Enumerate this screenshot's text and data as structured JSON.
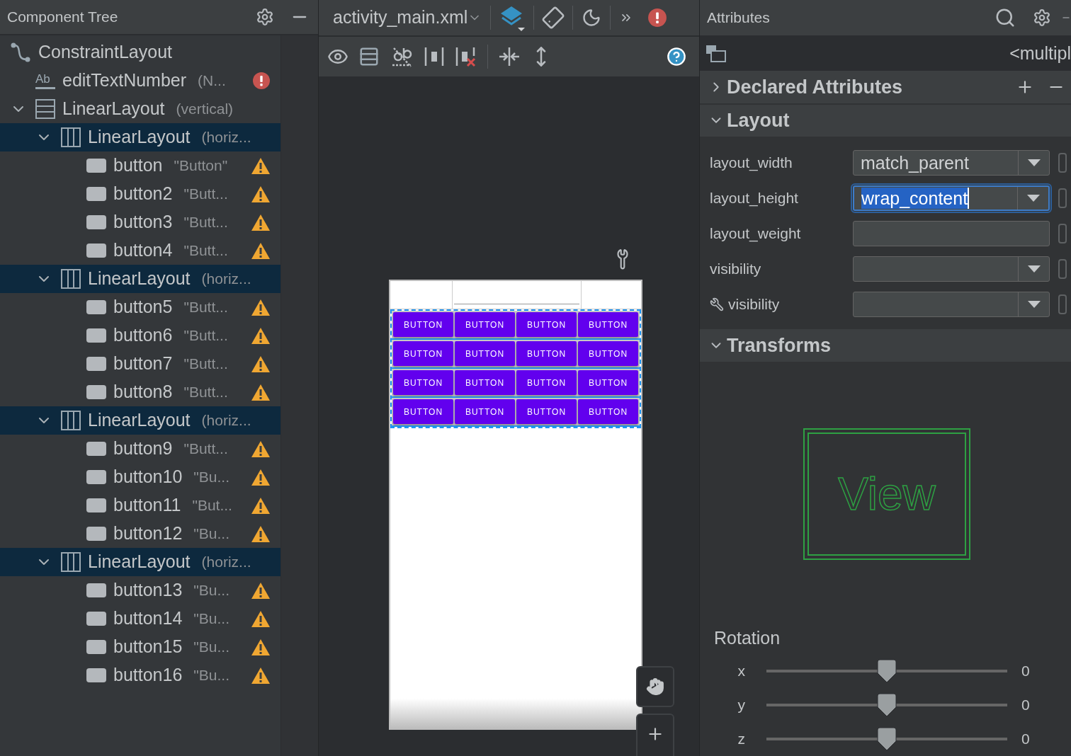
{
  "tree_panel": {
    "title": "Component Tree"
  },
  "component_tree": [
    {
      "name": "ConstraintLayout",
      "kind": "constraint",
      "selected": false,
      "error": false,
      "warning": false,
      "children": [
        {
          "name": "editTextNumber",
          "detail": "(N...",
          "kind": "edittext",
          "icon_label": "Ab",
          "error": true,
          "warning": false,
          "selected": false
        },
        {
          "name": "LinearLayout",
          "detail": "(vertical)",
          "kind": "linear_vertical",
          "expanded": true,
          "selected": false,
          "error": false,
          "warning": false,
          "children": [
            {
              "name": "LinearLayout",
              "detail": "(horiz...",
              "kind": "linear_horizontal",
              "expanded": true,
              "selected": true,
              "error": false,
              "warning": false,
              "children": [
                {
                  "name": "button",
                  "detail": "\"Button\"",
                  "kind": "button",
                  "error": false,
                  "warning": true,
                  "selected": false
                },
                {
                  "name": "button2",
                  "detail": "\"Butt...",
                  "kind": "button",
                  "error": false,
                  "warning": true,
                  "selected": false
                },
                {
                  "name": "button3",
                  "detail": "\"Butt...",
                  "kind": "button",
                  "error": false,
                  "warning": true,
                  "selected": false
                },
                {
                  "name": "button4",
                  "detail": "\"Butt...",
                  "kind": "button",
                  "error": false,
                  "warning": true,
                  "selected": false
                }
              ]
            },
            {
              "name": "LinearLayout",
              "detail": "(horiz...",
              "kind": "linear_horizontal",
              "expanded": true,
              "selected": true,
              "error": false,
              "warning": false,
              "children": [
                {
                  "name": "button5",
                  "detail": "\"Butt...",
                  "kind": "button",
                  "error": false,
                  "warning": true,
                  "selected": false
                },
                {
                  "name": "button6",
                  "detail": "\"Butt...",
                  "kind": "button",
                  "error": false,
                  "warning": true,
                  "selected": false
                },
                {
                  "name": "button7",
                  "detail": "\"Butt...",
                  "kind": "button",
                  "error": false,
                  "warning": true,
                  "selected": false
                },
                {
                  "name": "button8",
                  "detail": "\"Butt...",
                  "kind": "button",
                  "error": false,
                  "warning": true,
                  "selected": false
                }
              ]
            },
            {
              "name": "LinearLayout",
              "detail": "(horiz...",
              "kind": "linear_horizontal",
              "expanded": true,
              "selected": true,
              "error": false,
              "warning": false,
              "children": [
                {
                  "name": "button9",
                  "detail": "\"Butt...",
                  "kind": "button",
                  "error": false,
                  "warning": true,
                  "selected": false
                },
                {
                  "name": "button10",
                  "detail": "\"Bu...",
                  "kind": "button",
                  "error": false,
                  "warning": true,
                  "selected": false
                },
                {
                  "name": "button11",
                  "detail": "\"But...",
                  "kind": "button",
                  "error": false,
                  "warning": true,
                  "selected": false
                },
                {
                  "name": "button12",
                  "detail": "\"Bu...",
                  "kind": "button",
                  "error": false,
                  "warning": true,
                  "selected": false
                }
              ]
            },
            {
              "name": "LinearLayout",
              "detail": "(horiz...",
              "kind": "linear_horizontal",
              "expanded": true,
              "selected": true,
              "error": false,
              "warning": false,
              "children": [
                {
                  "name": "button13",
                  "detail": "\"Bu...",
                  "kind": "button",
                  "error": false,
                  "warning": true,
                  "selected": false
                },
                {
                  "name": "button14",
                  "detail": "\"Bu...",
                  "kind": "button",
                  "error": false,
                  "warning": true,
                  "selected": false
                },
                {
                  "name": "button15",
                  "detail": "\"Bu...",
                  "kind": "button",
                  "error": false,
                  "warning": true,
                  "selected": false
                },
                {
                  "name": "button16",
                  "detail": "\"Bu...",
                  "kind": "button",
                  "error": false,
                  "warning": true,
                  "selected": false
                }
              ]
            }
          ]
        }
      ]
    }
  ],
  "editor": {
    "file": "activity_main.xml"
  },
  "device_rows": [
    [
      {
        "label": "BUTTON"
      },
      {
        "label": "BUTTON"
      },
      {
        "label": "BUTTON"
      },
      {
        "label": "BUTTON"
      }
    ],
    [
      {
        "label": "BUTTON"
      },
      {
        "label": "BUTTON"
      },
      {
        "label": "BUTTON"
      },
      {
        "label": "BUTTON"
      }
    ],
    [
      {
        "label": "BUTTON"
      },
      {
        "label": "BUTTON"
      },
      {
        "label": "BUTTON"
      },
      {
        "label": "BUTTON"
      }
    ],
    [
      {
        "label": "BUTTON"
      },
      {
        "label": "BUTTON"
      },
      {
        "label": "BUTTON"
      },
      {
        "label": "BUTTON"
      }
    ]
  ],
  "attributes": {
    "title": "Attributes",
    "selection": "<multipl",
    "declared": {
      "title": "Declared Attributes",
      "expanded": false
    },
    "layout": {
      "title": "Layout",
      "expanded": true,
      "properties": [
        {
          "label": "layout_width",
          "kind": "dropdown",
          "value": "match_parent",
          "focused": false,
          "tool": false
        },
        {
          "label": "layout_height",
          "kind": "dropdown",
          "value": "wrap_content",
          "focused": true,
          "tool": false
        },
        {
          "label": "layout_weight",
          "kind": "text",
          "focused": false,
          "tool": false
        },
        {
          "label": "visibility",
          "kind": "dropdown",
          "focused": false,
          "tool": false
        },
        {
          "label": "visibility",
          "kind": "dropdown",
          "focused": false,
          "tool": true
        }
      ]
    },
    "transforms": {
      "title": "Transforms",
      "expanded": true,
      "preview": "View",
      "rotation": {
        "title": "Rotation",
        "axes": [
          {
            "label": "x",
            "level": 0.5,
            "reading": "0"
          },
          {
            "label": "y",
            "level": 0.5,
            "reading": "0"
          },
          {
            "label": "z",
            "level": 0.5,
            "reading": "0"
          }
        ]
      }
    }
  }
}
